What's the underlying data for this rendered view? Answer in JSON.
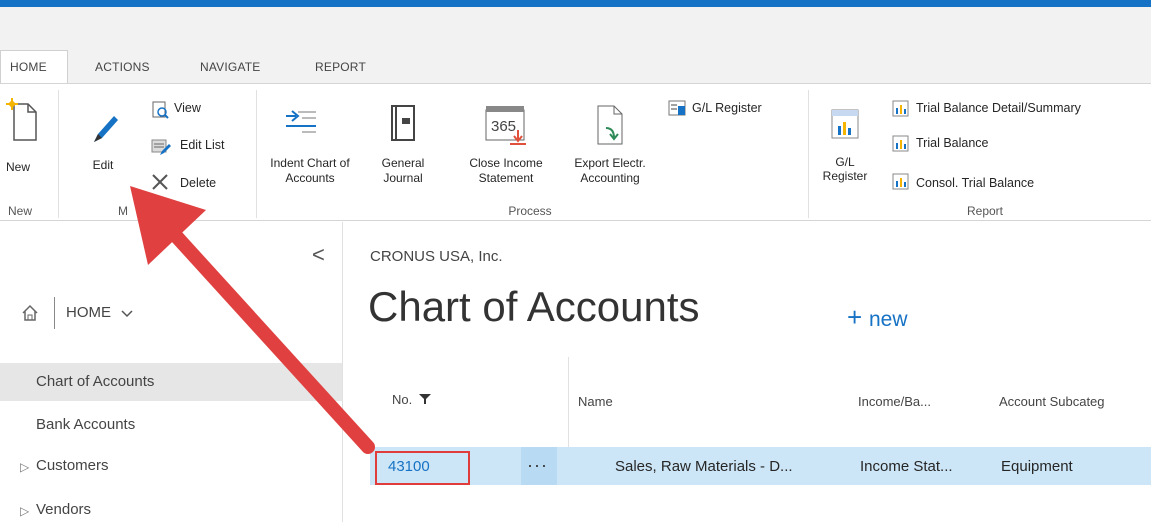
{
  "tabs": [
    "HOME",
    "ACTIONS",
    "NAVIGATE",
    "REPORT"
  ],
  "ribbon": {
    "new_group": {
      "button": "New",
      "label": "New"
    },
    "manage_group": {
      "edit": "Edit",
      "view": "View",
      "edit_list": "Edit List",
      "delete": "Delete",
      "label_visible": "M",
      "label_tail": "ge"
    },
    "process_group": {
      "indent": [
        "Indent Chart of",
        "Accounts"
      ],
      "general_journal": [
        "General",
        "Journal"
      ],
      "close_income": [
        "Close Income",
        "Statement"
      ],
      "export": [
        "Export Electr.",
        "Accounting"
      ],
      "gl_register": "G/L Register",
      "label": "Process",
      "calendar_text": "365"
    },
    "report_group": {
      "gl_register": [
        "G/L",
        "Register"
      ],
      "trial_detail": "Trial Balance Detail/Summary",
      "trial_balance": "Trial Balance",
      "consol": "Consol. Trial Balance",
      "label": "Report"
    }
  },
  "nav": {
    "collapse": "<",
    "home": "HOME",
    "items": [
      "Chart of Accounts",
      "Bank Accounts",
      "Customers",
      "Vendors"
    ],
    "expand_glyph": "▷"
  },
  "page": {
    "company": "CRONUS USA, Inc.",
    "title": "Chart of Accounts",
    "new_label": "new",
    "new_plus": "+"
  },
  "table": {
    "headers": {
      "no": "No.",
      "name": "Name",
      "income": "Income/Ba...",
      "subcat": "Account Subcateg"
    },
    "row": {
      "no": "43100",
      "dots": "···",
      "name": "Sales, Raw Materials - D...",
      "income": "Income Stat...",
      "subcat": "Equipment"
    }
  },
  "colors": {
    "accent": "#1672c4",
    "arrow": "#e04040",
    "highlight_box": "#e03c3c",
    "row_selected": "#cde6f7"
  }
}
